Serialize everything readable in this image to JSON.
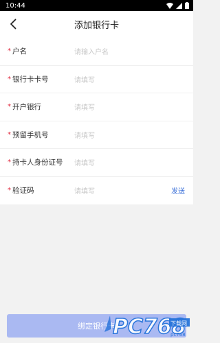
{
  "status_bar": {
    "time": "10:44"
  },
  "header": {
    "title": "添加银行卡",
    "back_icon": "chevron-left-icon"
  },
  "form": {
    "fields": [
      {
        "label": "户名",
        "placeholder": "请输入户名",
        "required": true
      },
      {
        "label": "银行卡卡号",
        "placeholder": "请填写",
        "required": true
      },
      {
        "label": "开户银行",
        "placeholder": "请填写",
        "required": true
      },
      {
        "label": "预留手机号",
        "placeholder": "请填写",
        "required": true
      },
      {
        "label": "持卡人身份证号",
        "placeholder": "请填写",
        "required": true
      },
      {
        "label": "验证码",
        "placeholder": "请填写",
        "required": true,
        "action": "发送"
      }
    ],
    "required_mark": "*"
  },
  "footer": {
    "bind_button_label": "绑定银行卡",
    "watermark": "PC768 pc下载网"
  },
  "colors": {
    "required": "#e0263b",
    "link": "#3a6fd8",
    "button_bg": "#aab9f2"
  }
}
